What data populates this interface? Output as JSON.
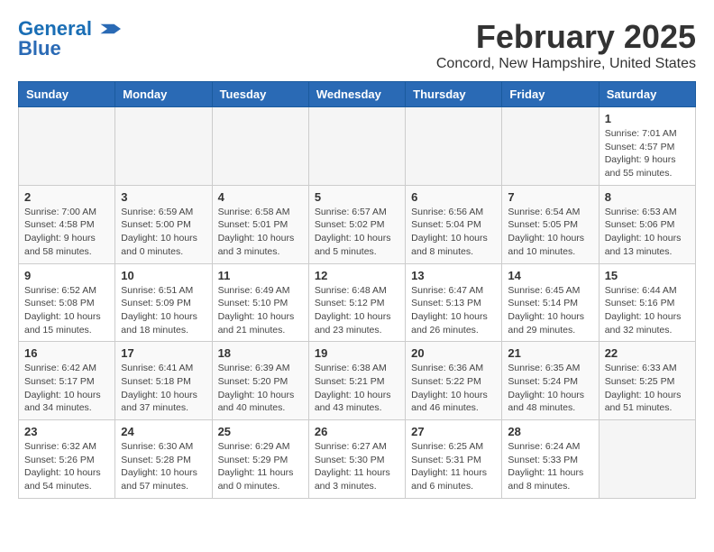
{
  "logo": {
    "line1": "General",
    "line2": "Blue"
  },
  "title": "February 2025",
  "subtitle": "Concord, New Hampshire, United States",
  "days_of_week": [
    "Sunday",
    "Monday",
    "Tuesday",
    "Wednesday",
    "Thursday",
    "Friday",
    "Saturday"
  ],
  "weeks": [
    [
      {
        "day": "",
        "info": ""
      },
      {
        "day": "",
        "info": ""
      },
      {
        "day": "",
        "info": ""
      },
      {
        "day": "",
        "info": ""
      },
      {
        "day": "",
        "info": ""
      },
      {
        "day": "",
        "info": ""
      },
      {
        "day": "1",
        "info": "Sunrise: 7:01 AM\nSunset: 4:57 PM\nDaylight: 9 hours and 55 minutes."
      }
    ],
    [
      {
        "day": "2",
        "info": "Sunrise: 7:00 AM\nSunset: 4:58 PM\nDaylight: 9 hours and 58 minutes."
      },
      {
        "day": "3",
        "info": "Sunrise: 6:59 AM\nSunset: 5:00 PM\nDaylight: 10 hours and 0 minutes."
      },
      {
        "day": "4",
        "info": "Sunrise: 6:58 AM\nSunset: 5:01 PM\nDaylight: 10 hours and 3 minutes."
      },
      {
        "day": "5",
        "info": "Sunrise: 6:57 AM\nSunset: 5:02 PM\nDaylight: 10 hours and 5 minutes."
      },
      {
        "day": "6",
        "info": "Sunrise: 6:56 AM\nSunset: 5:04 PM\nDaylight: 10 hours and 8 minutes."
      },
      {
        "day": "7",
        "info": "Sunrise: 6:54 AM\nSunset: 5:05 PM\nDaylight: 10 hours and 10 minutes."
      },
      {
        "day": "8",
        "info": "Sunrise: 6:53 AM\nSunset: 5:06 PM\nDaylight: 10 hours and 13 minutes."
      }
    ],
    [
      {
        "day": "9",
        "info": "Sunrise: 6:52 AM\nSunset: 5:08 PM\nDaylight: 10 hours and 15 minutes."
      },
      {
        "day": "10",
        "info": "Sunrise: 6:51 AM\nSunset: 5:09 PM\nDaylight: 10 hours and 18 minutes."
      },
      {
        "day": "11",
        "info": "Sunrise: 6:49 AM\nSunset: 5:10 PM\nDaylight: 10 hours and 21 minutes."
      },
      {
        "day": "12",
        "info": "Sunrise: 6:48 AM\nSunset: 5:12 PM\nDaylight: 10 hours and 23 minutes."
      },
      {
        "day": "13",
        "info": "Sunrise: 6:47 AM\nSunset: 5:13 PM\nDaylight: 10 hours and 26 minutes."
      },
      {
        "day": "14",
        "info": "Sunrise: 6:45 AM\nSunset: 5:14 PM\nDaylight: 10 hours and 29 minutes."
      },
      {
        "day": "15",
        "info": "Sunrise: 6:44 AM\nSunset: 5:16 PM\nDaylight: 10 hours and 32 minutes."
      }
    ],
    [
      {
        "day": "16",
        "info": "Sunrise: 6:42 AM\nSunset: 5:17 PM\nDaylight: 10 hours and 34 minutes."
      },
      {
        "day": "17",
        "info": "Sunrise: 6:41 AM\nSunset: 5:18 PM\nDaylight: 10 hours and 37 minutes."
      },
      {
        "day": "18",
        "info": "Sunrise: 6:39 AM\nSunset: 5:20 PM\nDaylight: 10 hours and 40 minutes."
      },
      {
        "day": "19",
        "info": "Sunrise: 6:38 AM\nSunset: 5:21 PM\nDaylight: 10 hours and 43 minutes."
      },
      {
        "day": "20",
        "info": "Sunrise: 6:36 AM\nSunset: 5:22 PM\nDaylight: 10 hours and 46 minutes."
      },
      {
        "day": "21",
        "info": "Sunrise: 6:35 AM\nSunset: 5:24 PM\nDaylight: 10 hours and 48 minutes."
      },
      {
        "day": "22",
        "info": "Sunrise: 6:33 AM\nSunset: 5:25 PM\nDaylight: 10 hours and 51 minutes."
      }
    ],
    [
      {
        "day": "23",
        "info": "Sunrise: 6:32 AM\nSunset: 5:26 PM\nDaylight: 10 hours and 54 minutes."
      },
      {
        "day": "24",
        "info": "Sunrise: 6:30 AM\nSunset: 5:28 PM\nDaylight: 10 hours and 57 minutes."
      },
      {
        "day": "25",
        "info": "Sunrise: 6:29 AM\nSunset: 5:29 PM\nDaylight: 11 hours and 0 minutes."
      },
      {
        "day": "26",
        "info": "Sunrise: 6:27 AM\nSunset: 5:30 PM\nDaylight: 11 hours and 3 minutes."
      },
      {
        "day": "27",
        "info": "Sunrise: 6:25 AM\nSunset: 5:31 PM\nDaylight: 11 hours and 6 minutes."
      },
      {
        "day": "28",
        "info": "Sunrise: 6:24 AM\nSunset: 5:33 PM\nDaylight: 11 hours and 8 minutes."
      },
      {
        "day": "",
        "info": ""
      }
    ]
  ]
}
